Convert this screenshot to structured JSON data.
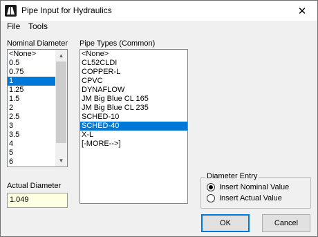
{
  "window": {
    "title": "Pipe Input for Hydraulics",
    "close_glyph": "✕",
    "icon": "app-icon"
  },
  "menu": {
    "file": "File",
    "tools": "Tools"
  },
  "nominal": {
    "label": "Nominal Diameter",
    "items": [
      "<None>",
      "0.5",
      "0.75",
      "1",
      "1.25",
      "1.5",
      "2",
      "2.5",
      "3",
      "3.5",
      "4",
      "5",
      "6"
    ],
    "selected": "1"
  },
  "pipe_types": {
    "label": "Pipe Types (Common)",
    "items": [
      "<None>",
      "CL52CLDI",
      "COPPER-L",
      "CPVC",
      "DYNAFLOW",
      "JM Big Blue CL 165",
      "JM Big Blue CL 235",
      "SCHED-10",
      "SCHED-40",
      "X-L",
      "[-MORE-->]"
    ],
    "selected": "SCHED-40"
  },
  "actual": {
    "label": "Actual Diameter",
    "value": "1.049"
  },
  "diameter_entry": {
    "title": "Diameter Entry",
    "options": [
      "Insert Nominal Value",
      "Insert Actual Value"
    ],
    "selected": "Insert Nominal Value"
  },
  "buttons": {
    "ok": "OK",
    "cancel": "Cancel"
  },
  "colors": {
    "selection": "#0078d7",
    "actual_bg": "#ffffe1"
  },
  "icons": {
    "scroll_up": "▲",
    "scroll_down": "▼"
  }
}
